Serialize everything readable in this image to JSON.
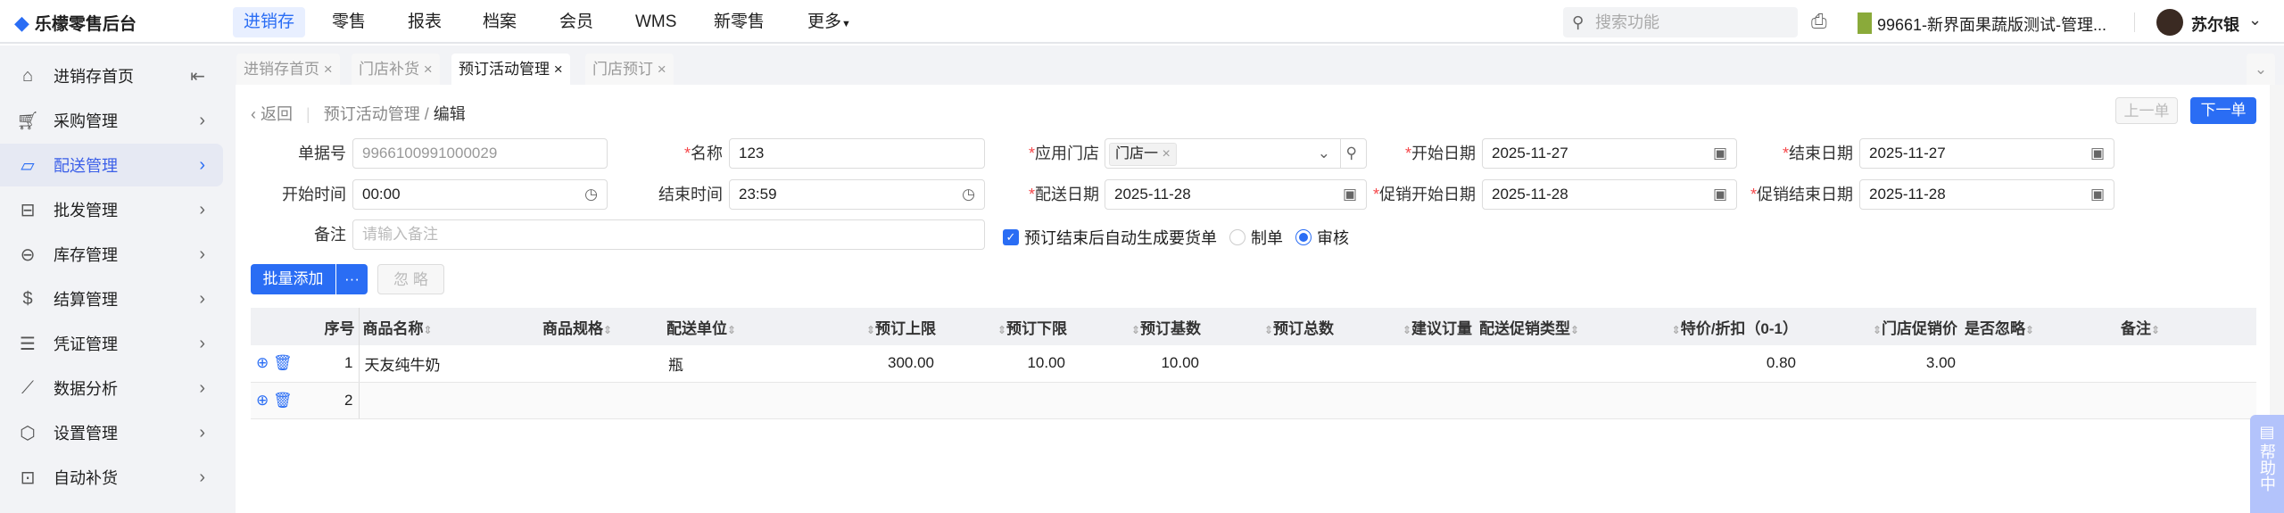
{
  "app": {
    "title": "乐檬零售后台"
  },
  "nav": {
    "items": [
      "进销存",
      "零售",
      "报表",
      "档案",
      "会员",
      "WMS",
      "新零售",
      "更多"
    ],
    "active": "进销存"
  },
  "header": {
    "search_placeholder": "搜索功能",
    "store": "99661-新界面果蔬版测试-管理...",
    "user": "苏尔银"
  },
  "sidebar": {
    "items": [
      {
        "label": "进销存首页",
        "icon": "home-icon"
      },
      {
        "label": "采购管理",
        "icon": "cart-icon"
      },
      {
        "label": "配送管理",
        "icon": "map-icon"
      },
      {
        "label": "批发管理",
        "icon": "drawer-icon"
      },
      {
        "label": "库存管理",
        "icon": "box-icon"
      },
      {
        "label": "结算管理",
        "icon": "dollar-icon"
      },
      {
        "label": "凭证管理",
        "icon": "document-icon"
      },
      {
        "label": "数据分析",
        "icon": "chart-icon"
      },
      {
        "label": "设置管理",
        "icon": "gear-icon"
      },
      {
        "label": "自动补货",
        "icon": "basket-icon"
      }
    ],
    "active": "配送管理"
  },
  "tabs": [
    {
      "label": "进销存首页"
    },
    {
      "label": "门店补货"
    },
    {
      "label": "预订活动管理"
    },
    {
      "label": "门店预订"
    }
  ],
  "breadcrumb": {
    "back": "返回",
    "parent": "预订活动管理",
    "sep": "/",
    "current": "编辑"
  },
  "pager": {
    "prev": "上一单",
    "next": "下一单"
  },
  "form": {
    "doc_no": {
      "label": "单据号",
      "value": "9966100991000029"
    },
    "name": {
      "label": "名称",
      "value": "123"
    },
    "store": {
      "label": "应用门店",
      "tag": "门店一"
    },
    "start_date": {
      "label": "开始日期",
      "value": "2025-11-27"
    },
    "end_date": {
      "label": "结束日期",
      "value": "2025-11-27"
    },
    "start_time": {
      "label": "开始时间",
      "value": "00:00"
    },
    "end_time": {
      "label": "结束时间",
      "value": "23:59"
    },
    "delivery_date": {
      "label": "配送日期",
      "value": "2025-11-28"
    },
    "promo_start": {
      "label": "促销开始日期",
      "value": "2025-11-28"
    },
    "promo_end": {
      "label": "促销结束日期",
      "value": "2025-11-28"
    },
    "remark": {
      "label": "备注",
      "placeholder": "请输入备注"
    },
    "auto_gen": {
      "label": "预订结束后自动生成要货单",
      "checked": true
    },
    "radio": {
      "options": [
        "制单",
        "审核"
      ],
      "selected": "审核"
    }
  },
  "actions": {
    "batch_add": "批量添加",
    "more": "···",
    "ignore": "忽 略"
  },
  "table": {
    "columns": [
      "序号",
      "商品名称",
      "商品规格",
      "配送单位",
      "预订上限",
      "预订下限",
      "预订基数",
      "预订总数",
      "建议订量",
      "配送促销类型",
      "特价/折扣（0-1）",
      "门店促销价",
      "是否忽略",
      "备注"
    ],
    "rows": [
      {
        "seq": "1",
        "name": "天友纯牛奶",
        "spec": "",
        "unit": "瓶",
        "max": "300.00",
        "min": "10.00",
        "base": "10.00",
        "total": "",
        "suggest": "",
        "promo_type": "",
        "discount": "0.80",
        "promo_price": "3.00",
        "ignore": "",
        "remark": ""
      },
      {
        "seq": "2",
        "name": "",
        "spec": "",
        "unit": "",
        "max": "",
        "min": "",
        "base": "",
        "total": "",
        "suggest": "",
        "promo_type": "",
        "discount": "",
        "promo_price": "",
        "ignore": "",
        "remark": ""
      }
    ]
  },
  "help": {
    "label": "帮助中"
  },
  "colors": {
    "accent": "#2a6df4",
    "required": "#f5484b"
  }
}
